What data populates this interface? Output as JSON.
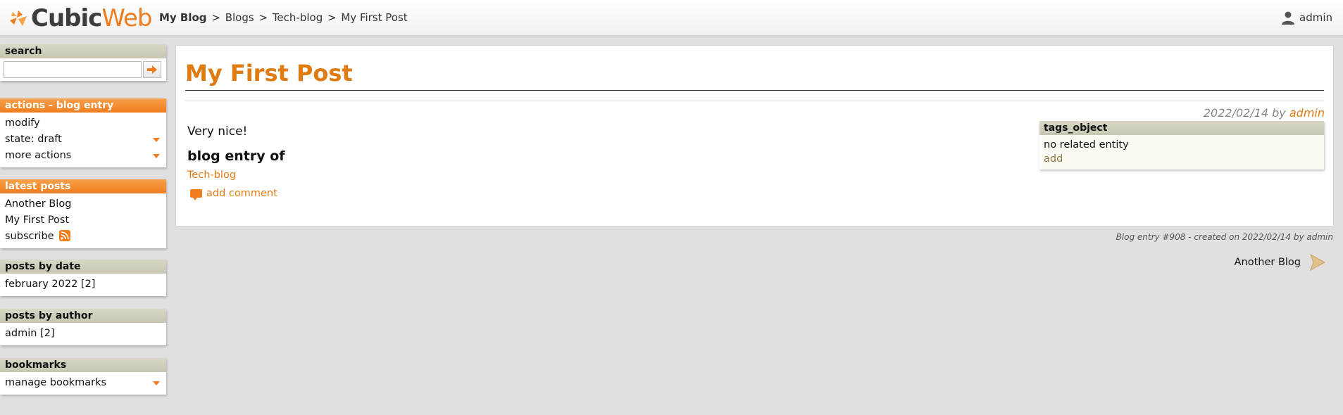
{
  "header": {
    "logo": {
      "cubic": "Cubic",
      "web": "Web"
    },
    "breadcrumb": {
      "root": "My Blog",
      "sep1": ">",
      "blogs": "Blogs",
      "sep2": ">",
      "techblog": "Tech-blog",
      "sep3": ">",
      "current": "My First Post"
    },
    "user": "admin"
  },
  "sidebar": {
    "search": {
      "title": "search",
      "placeholder": ""
    },
    "actions": {
      "title": "actions - blog entry",
      "items": [
        "modify",
        "state: draft",
        "more actions"
      ]
    },
    "latest": {
      "title": "latest posts",
      "items": [
        "Another Blog",
        "My First Post",
        "subscribe"
      ]
    },
    "by_date": {
      "title": "posts by date",
      "items": [
        "february 2022 [2]"
      ]
    },
    "by_author": {
      "title": "posts by author",
      "items": [
        "admin [2]"
      ]
    },
    "bookmarks": {
      "title": "bookmarks",
      "items": [
        "manage bookmarks"
      ]
    }
  },
  "post": {
    "title": "My First Post",
    "date": "2022/02/14",
    "by": "by",
    "author": "admin",
    "text": "Very nice!",
    "relation_heading": "blog entry of",
    "relation_link": "Tech-blog",
    "add_comment": "add comment"
  },
  "tags": {
    "title": "tags_object",
    "empty": "no related entity",
    "add": "add"
  },
  "footer": {
    "meta": "Blog entry #908 - created on 2022/02/14 by admin",
    "next": "Another Blog"
  },
  "colors": {
    "accent": "#f07e1e",
    "link": "#e07b12",
    "box_header": "#d2d1be"
  }
}
